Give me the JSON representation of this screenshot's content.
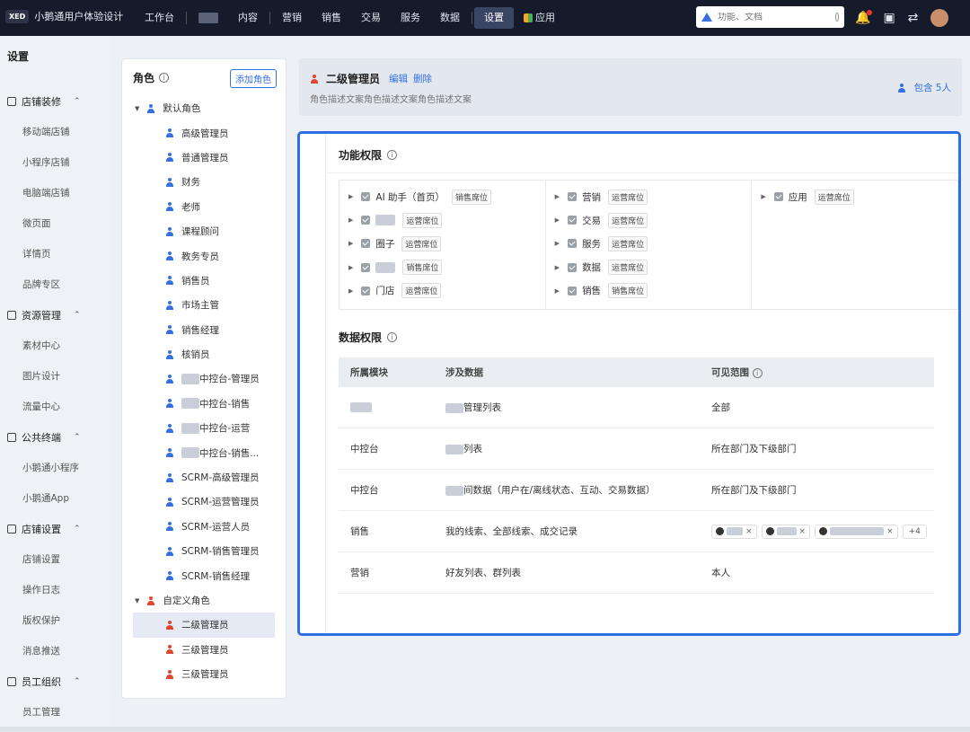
{
  "topbar": {
    "logo": "XED",
    "app_name": "小鹅通用户体验设计",
    "nav": [
      "工作台",
      "",
      "内容",
      "营销",
      "销售",
      "交易",
      "服务",
      "数据",
      "设置",
      "应用"
    ],
    "active_nav": "设置",
    "search_placeholder": "功能、文档"
  },
  "leftnav": {
    "title": "设置",
    "groups": [
      {
        "label": "店铺装修",
        "items": [
          "移动端店铺",
          "小程序店铺",
          "电脑端店铺",
          "微页面",
          "详情页",
          "品牌专区"
        ]
      },
      {
        "label": "资源管理",
        "items": [
          "素材中心",
          "图片设计",
          "流量中心"
        ]
      },
      {
        "label": "公共终端",
        "items": [
          "小鹅通小程序",
          "小鹅通App"
        ]
      },
      {
        "label": "店铺设置",
        "items": [
          "店铺设置",
          "操作日志",
          "版权保护",
          "消息推送"
        ]
      },
      {
        "label": "员工组织",
        "items": [
          "员工管理"
        ]
      }
    ]
  },
  "roles": {
    "title": "角色",
    "add_button": "添加角色",
    "default_group": "默认角色",
    "default_roles": [
      "高级管理员",
      "普通管理员",
      "财务",
      "老师",
      "课程顾问",
      "教务专员",
      "销售员",
      "市场主管",
      "销售经理",
      "核销员",
      "中控台-管理员",
      "中控台-销售",
      "中控台-运营",
      "中控台-销售...",
      "SCRM-高级管理员",
      "SCRM-运营管理员",
      "SCRM-运营人员",
      "SCRM-销售管理员",
      "SCRM-销售经理"
    ],
    "custom_group": "自定义角色",
    "custom_roles": [
      "二级管理员",
      "三级管理员",
      "三级管理员"
    ],
    "selected": "二级管理员"
  },
  "role_header": {
    "name": "二级管理员",
    "edit": "编辑",
    "delete": "删除",
    "description": "角色描述文案角色描述文案角色描述文案",
    "member_count": "包含 5人"
  },
  "function_perms": {
    "title": "功能权限",
    "columns": [
      [
        {
          "label": "AI 助手（首页）",
          "tag": "销售席位"
        },
        {
          "label": "",
          "tag": "运营席位"
        },
        {
          "label": "圈子",
          "tag": "运营席位"
        },
        {
          "label": "",
          "tag": "销售席位"
        },
        {
          "label": "门店",
          "tag": "运营席位"
        }
      ],
      [
        {
          "label": "营销",
          "tag": "运营席位"
        },
        {
          "label": "交易",
          "tag": "运营席位"
        },
        {
          "label": "服务",
          "tag": "运营席位"
        },
        {
          "label": "数据",
          "tag": "运营席位"
        },
        {
          "label": "销售",
          "tag": "销售席位"
        }
      ],
      [
        {
          "label": "应用",
          "tag": "运营席位"
        }
      ]
    ]
  },
  "data_perms": {
    "title": "数据权限",
    "headers": [
      "所属模块",
      "涉及数据",
      "可见范围"
    ],
    "rows": [
      {
        "module": "",
        "data": "管理列表",
        "scope": "全部"
      },
      {
        "module": "中控台",
        "data": "列表",
        "scope": "所在部门及下级部门"
      },
      {
        "module": "中控台",
        "data": "间数据（用户在/离线状态、互动、交易数据）",
        "scope": "所在部门及下级部门"
      },
      {
        "module": "销售",
        "data": "我的线索、全部线索、成交记录",
        "scope": "",
        "more": "+4"
      },
      {
        "module": "营销",
        "data": "好友列表、群列表",
        "scope": "本人"
      }
    ]
  },
  "colors": {
    "accent": "#3470e4",
    "topbar": "#151b2b",
    "highlight_border": "#2f6fe4",
    "role_icon_default": "#3470e4",
    "role_icon_custom": "#e2452e"
  }
}
